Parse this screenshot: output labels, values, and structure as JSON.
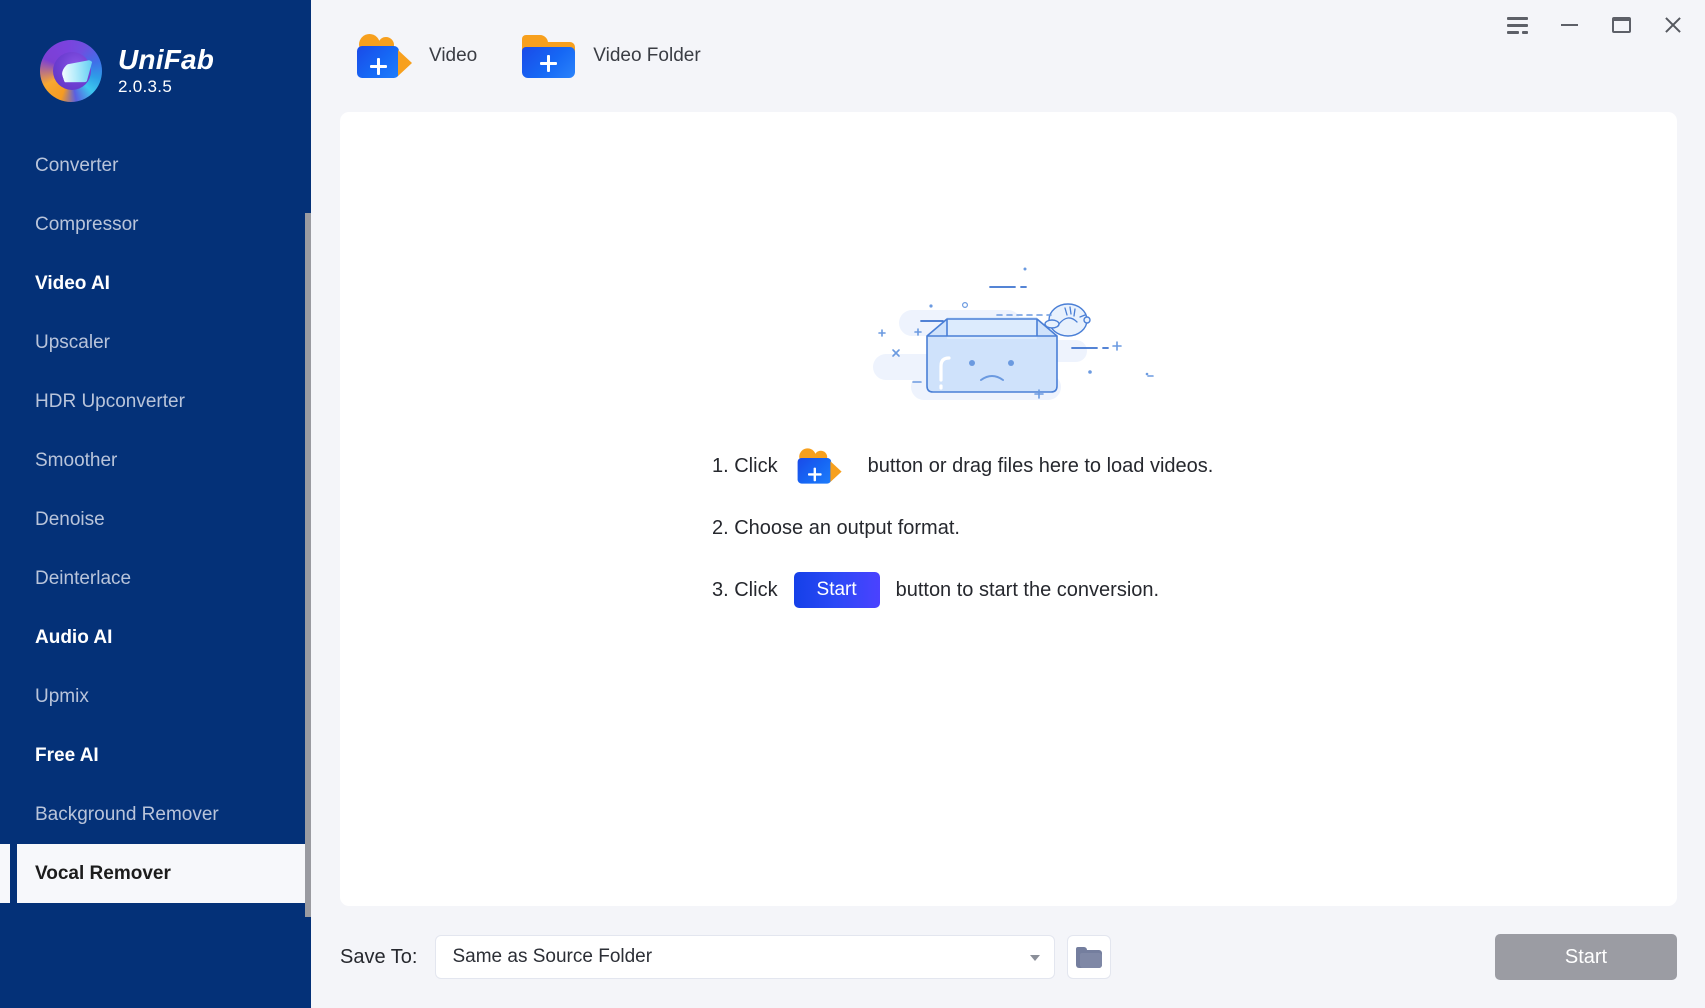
{
  "brand": {
    "name": "UniFab",
    "version": "2.0.3.5",
    "logo_icon": "unifab-swirl-logo"
  },
  "sidebar": {
    "items": [
      {
        "label": "Converter",
        "type": "item",
        "selected": false
      },
      {
        "label": "Compressor",
        "type": "item",
        "selected": false
      },
      {
        "label": "Video AI",
        "type": "group",
        "selected": false
      },
      {
        "label": "Upscaler",
        "type": "item",
        "selected": false
      },
      {
        "label": "HDR Upconverter",
        "type": "item",
        "selected": false
      },
      {
        "label": "Smoother",
        "type": "item",
        "selected": false
      },
      {
        "label": "Denoise",
        "type": "item",
        "selected": false
      },
      {
        "label": "Deinterlace",
        "type": "item",
        "selected": false
      },
      {
        "label": "Audio AI",
        "type": "group",
        "selected": false
      },
      {
        "label": "Upmix",
        "type": "item",
        "selected": false
      },
      {
        "label": "Free AI",
        "type": "group",
        "selected": false
      },
      {
        "label": "Background Remover",
        "type": "item",
        "selected": false
      },
      {
        "label": "Vocal Remover",
        "type": "item",
        "selected": true
      }
    ]
  },
  "titlebar": {
    "menu_icon": "hamburger-menu-icon",
    "minimize_icon": "minimize-icon",
    "maximize_icon": "maximize-icon",
    "close_icon": "close-icon"
  },
  "addbar": {
    "video": {
      "label": "Video",
      "icon": "add-video-camera-icon"
    },
    "video_folder": {
      "label": "Video Folder",
      "icon": "add-video-folder-icon"
    }
  },
  "empty_state": {
    "illustration": "empty-box-sad-face-illustration",
    "steps": [
      {
        "num": "1. Click",
        "icon": "add-video-camera-icon",
        "tail": "button or drag files here to load videos."
      },
      {
        "num": "2. Choose an output format.",
        "icon": null,
        "tail": ""
      },
      {
        "num": "3. Click",
        "button": "Start",
        "tail": "button to start the conversion."
      }
    ]
  },
  "bottom": {
    "save_to_label": "Save To:",
    "save_to_value": "Same as Source Folder",
    "save_to_placeholder": "Same as Source Folder",
    "caret_icon": "chevron-down-icon",
    "browse_icon": "folder-icon",
    "start_label": "Start"
  },
  "colors": {
    "sidebar_bg": "#043178",
    "accent_blue": "#1668f5",
    "accent_orange": "#f7a01e",
    "page_bg": "#f4f5f9",
    "card_bg": "#ffffff",
    "start_disabled": "#9b9ca3"
  }
}
